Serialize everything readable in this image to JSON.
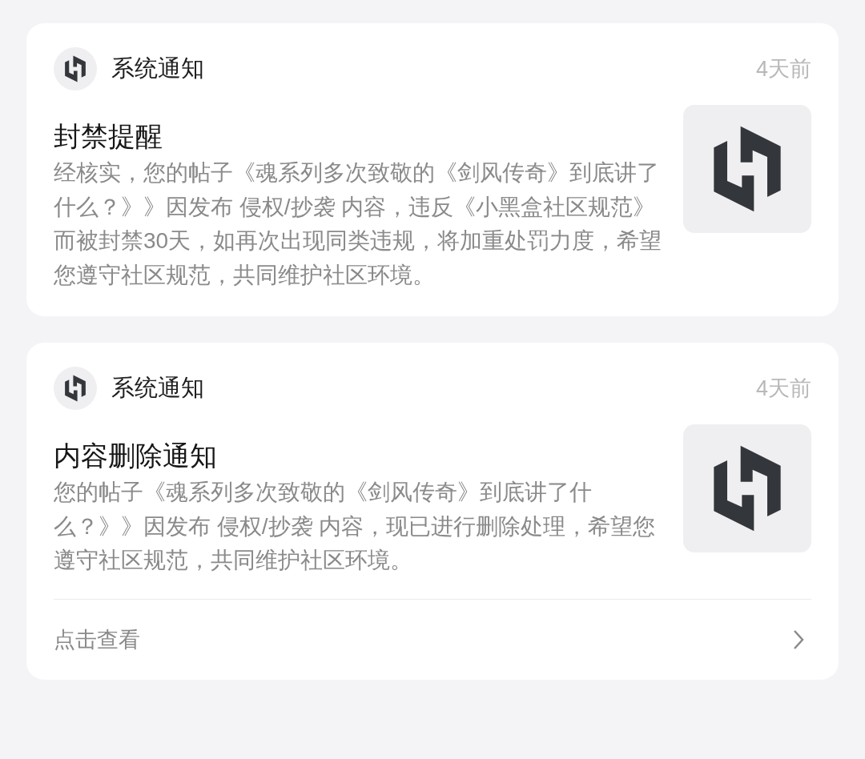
{
  "notifications": [
    {
      "sender": "系统通知",
      "time": "4天前",
      "title": "封禁提醒",
      "body": "经核实，您的帖子《魂系列多次致敬的《剑风传奇》到底讲了什么？》》因发布 侵权/抄袭 内容，违反《小黑盒社区规范》而被封禁30天，如再次出现同类违规，将加重处罚力度，希望您遵守社区规范，共同维护社区环境。"
    },
    {
      "sender": "系统通知",
      "time": "4天前",
      "title": "内容删除通知",
      "body": "您的帖子《魂系列多次致敬的《剑风传奇》到底讲了什么？》》因发布 侵权/抄袭 内容，现已进行删除处理，希望您遵守社区规范，共同维护社区环境。",
      "link": "点击查看"
    }
  ]
}
